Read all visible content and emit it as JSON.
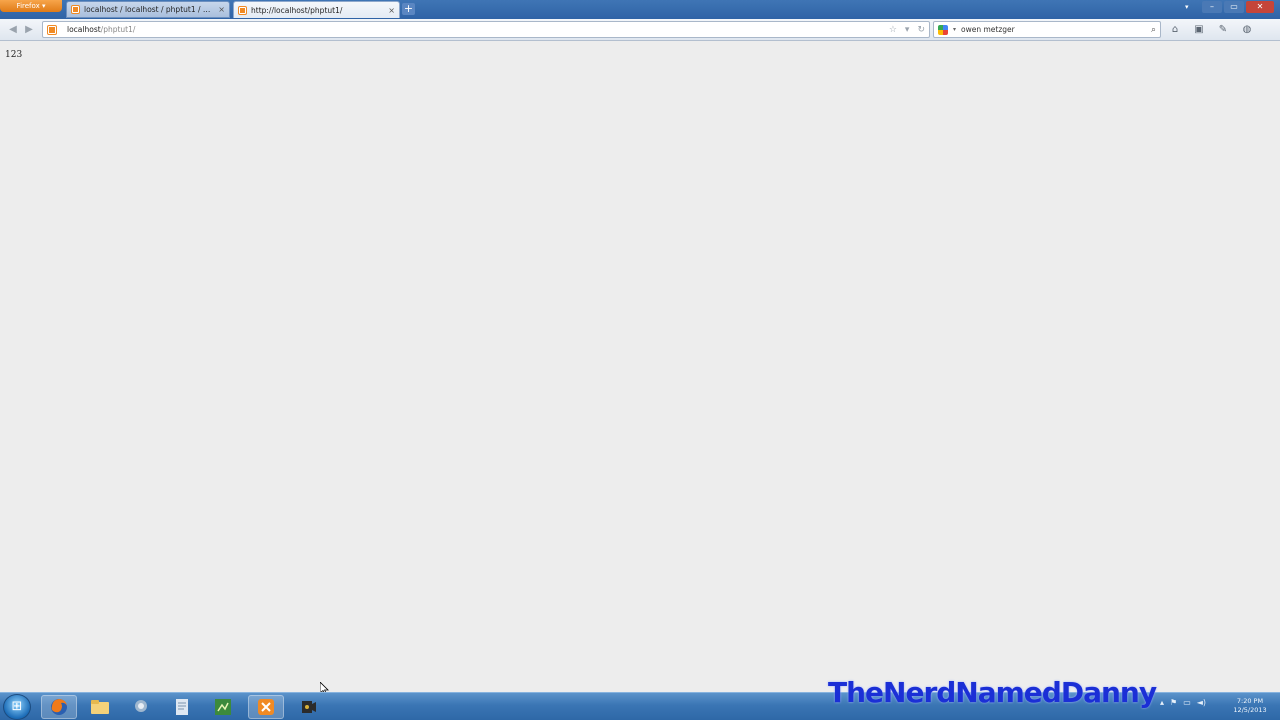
{
  "browser": {
    "menu_label": "Firefox ▾",
    "tabs": [
      {
        "label": "localhost / localhost / phptut1 / users...",
        "active": false
      },
      {
        "label": "http://localhost/phptut1/",
        "active": true
      }
    ],
    "new_tab": "+",
    "url_host": "localhost",
    "url_path": "/phptut1/",
    "search_value": "owen metzger"
  },
  "page": {
    "body_text": "123"
  },
  "taskbar": {
    "apps": [
      "firefox",
      "file-explorer",
      "chat-app",
      "notepad",
      "program-manager",
      "xampp",
      "recorder"
    ],
    "clock_time": "7:20 PM",
    "clock_date": "12/5/2013"
  },
  "watermark": "TheNerdNamedDanny",
  "colors": {
    "titlebar": "#3a6db0",
    "accent_orange": "#f08a24",
    "page_bg": "#ededed",
    "watermark": "#1b2fd6"
  }
}
